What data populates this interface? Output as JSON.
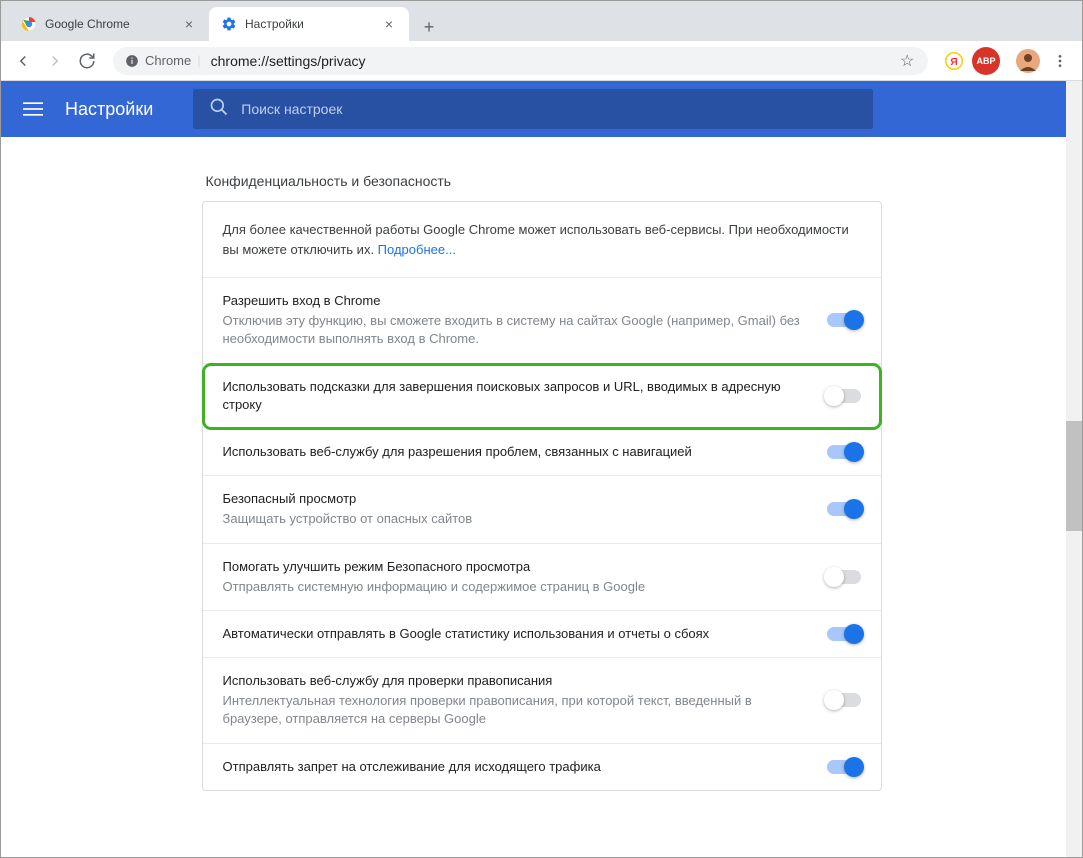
{
  "window": {
    "tabs": [
      {
        "title": "Google Chrome",
        "active": false
      },
      {
        "title": "Настройки",
        "active": true
      }
    ]
  },
  "toolbar": {
    "secure_label": "Chrome",
    "url": "chrome://settings/privacy"
  },
  "header": {
    "title": "Настройки",
    "search_placeholder": "Поиск настроек"
  },
  "section": {
    "title": "Конфиденциальность и безопасность"
  },
  "intro": {
    "text": "Для более качественной работы Google Chrome может использовать веб-сервисы. При необходимости вы можете отключить их. ",
    "link": "Подробнее..."
  },
  "rows": [
    {
      "label": "Разрешить вход в Chrome",
      "sub": "Отключив эту функцию, вы сможете входить в систему на сайтах Google (например, Gmail) без необходимости выполнять вход в Chrome.",
      "on": true,
      "highlighted": false
    },
    {
      "label": "Использовать подсказки для завершения поисковых запросов и URL, вводимых в адресную строку",
      "sub": "",
      "on": false,
      "highlighted": true
    },
    {
      "label": "Использовать веб-службу для разрешения проблем, связанных с навигацией",
      "sub": "",
      "on": true,
      "highlighted": false
    },
    {
      "label": "Безопасный просмотр",
      "sub": "Защищать устройство от опасных сайтов",
      "on": true,
      "highlighted": false
    },
    {
      "label": "Помогать улучшить режим Безопасного просмотра",
      "sub": "Отправлять системную информацию и содержимое страниц в Google",
      "on": false,
      "highlighted": false
    },
    {
      "label": "Автоматически отправлять в Google статистику использования и отчеты о сбоях",
      "sub": "",
      "on": true,
      "highlighted": false
    },
    {
      "label": "Использовать веб-службу для проверки правописания",
      "sub": "Интеллектуальная технология проверки правописания, при которой текст, введенный в браузере, отправляется на серверы Google",
      "on": false,
      "highlighted": false
    },
    {
      "label": "Отправлять запрет на отслеживание для исходящего трафика",
      "sub": "",
      "on": true,
      "highlighted": false
    }
  ],
  "colors": {
    "accent": "#1a73e8",
    "header": "#3367d6",
    "highlight": "#3db321"
  }
}
